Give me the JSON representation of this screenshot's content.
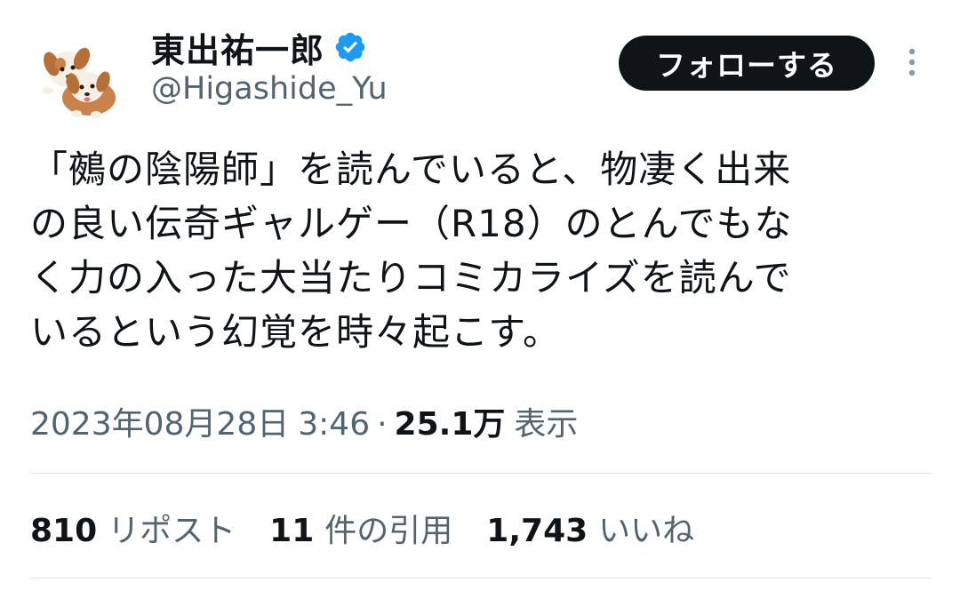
{
  "author": {
    "display_name": "東出祐一郎",
    "handle": "@Higashide_Yu",
    "avatar_icon": "dogs-avatar-icon",
    "verified_icon": "verified-badge-icon"
  },
  "actions": {
    "follow_label": "フォローする",
    "more_icon": "more-dots-vertical-icon"
  },
  "tweet": {
    "text": "「鵺の陰陽師」を読んでいると、物凄く出来\nの良い伝奇ギャルゲー（R18）のとんでもな\nく力の入った大当たりコミカライズを読んで\nいるという幻覚を時々起こす。"
  },
  "meta": {
    "date": "2023年08月28日",
    "time": "3:46",
    "separator": "·",
    "views_count": "25.1万",
    "views_label": "表示"
  },
  "stats": {
    "reposts_count": "810",
    "reposts_label": "リポスト",
    "quotes_count": "11",
    "quotes_label": "件の引用",
    "likes_count": "1,743",
    "likes_label": "いいね"
  },
  "colors": {
    "text_primary": "#0f1419",
    "text_secondary": "#536471",
    "verified_blue": "#1d9bf0",
    "follow_button_bg": "#0f1419",
    "divider": "#e1e4e7"
  }
}
